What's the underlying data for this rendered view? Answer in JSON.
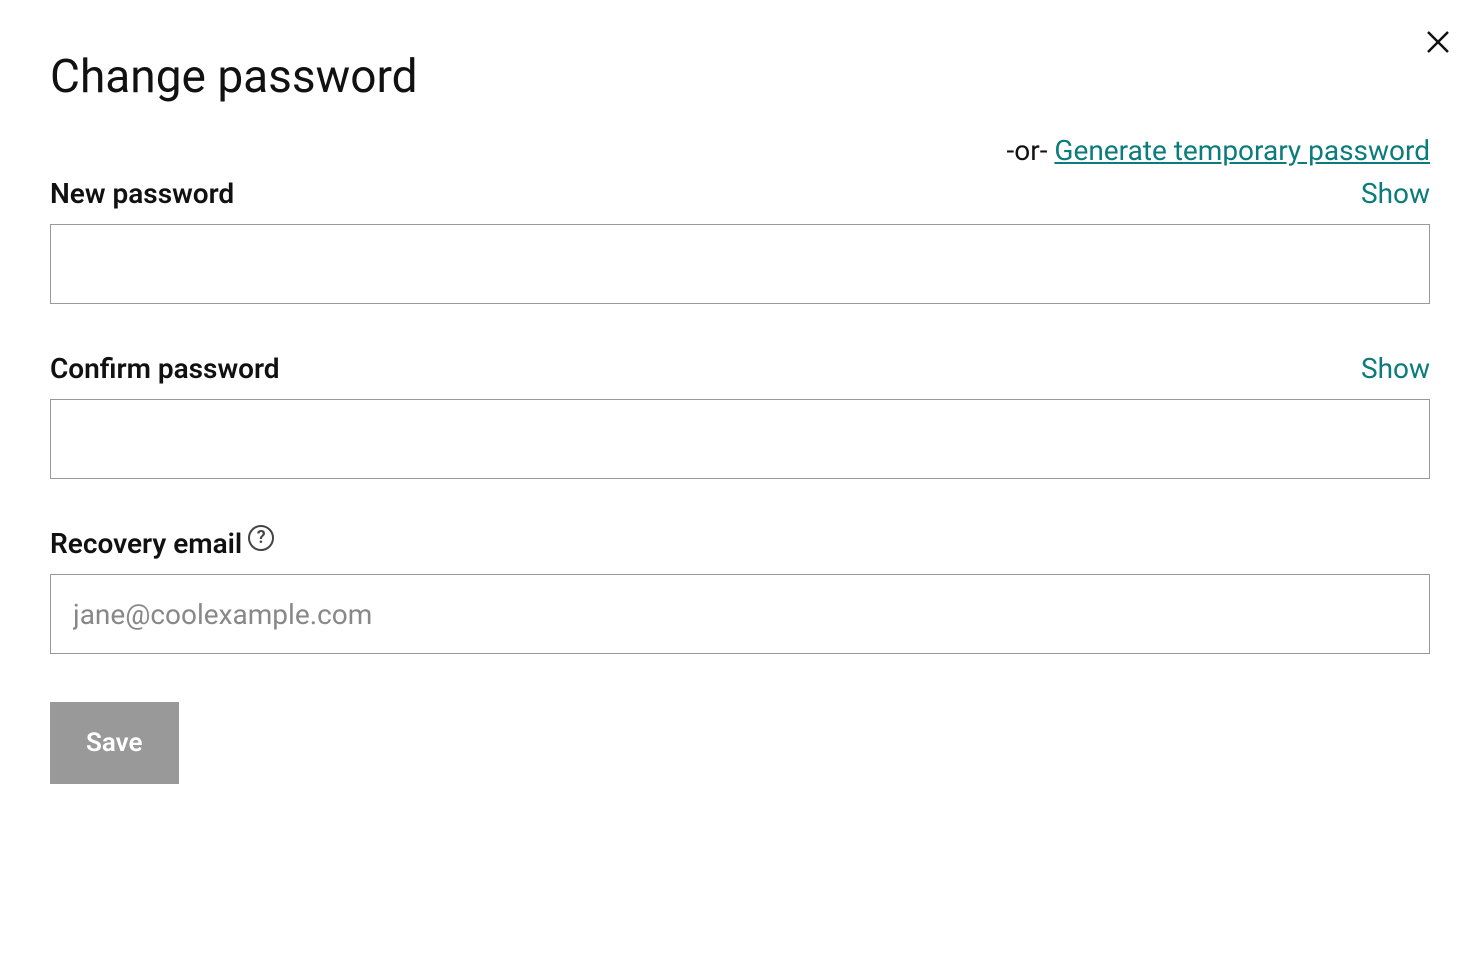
{
  "title": "Change password",
  "close_label": "Close",
  "alt_row": {
    "or_text": "-or- ",
    "generate_link": "Generate temporary password"
  },
  "fields": {
    "new_password": {
      "label": "New password",
      "show": "Show",
      "value": ""
    },
    "confirm_password": {
      "label": "Confirm password",
      "show": "Show",
      "value": ""
    },
    "recovery_email": {
      "label": "Recovery email",
      "placeholder": "jane@coolexample.com",
      "value": "",
      "help": "?"
    }
  },
  "save_button": "Save"
}
